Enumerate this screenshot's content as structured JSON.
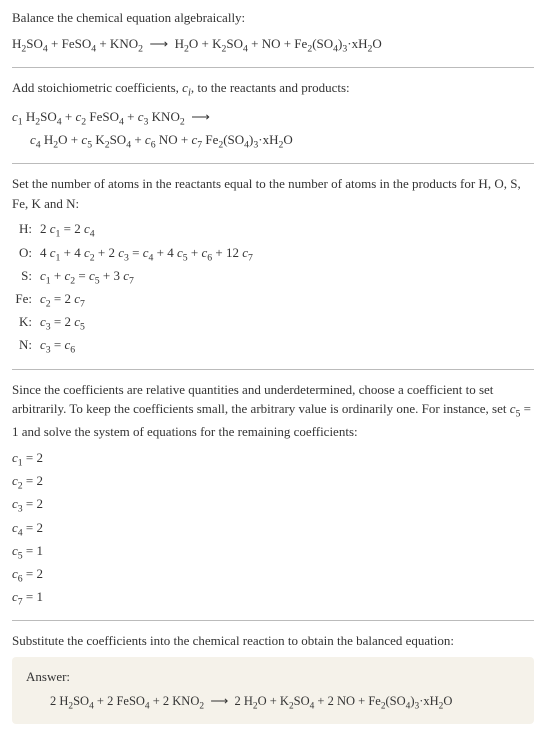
{
  "intro_text": "Balance the chemical equation algebraically:",
  "unbalanced_equation": "H₂SO₄ + FeSO₄ + KNO₂ ⟶ H₂O + K₂SO₄ + NO + Fe₂(SO₄)₃·xH₂O",
  "stoich_text_part1": "Add stoichiometric coefficients, ",
  "stoich_text_ci": "cᵢ",
  "stoich_text_part2": ", to the reactants and products:",
  "stoich_equation_line1": "c₁ H₂SO₄ + c₂ FeSO₄ + c₃ KNO₂ ⟶",
  "stoich_equation_line2": "c₄ H₂O + c₅ K₂SO₄ + c₆ NO + c₇ Fe₂(SO₄)₃·xH₂O",
  "atoms_text": "Set the number of atoms in the reactants equal to the number of atoms in the products for H, O, S, Fe, K and N:",
  "balance_rows": [
    {
      "label": "H:",
      "eq": "2 c₁ = 2 c₄"
    },
    {
      "label": "O:",
      "eq": "4 c₁ + 4 c₂ + 2 c₃ = c₄ + 4 c₅ + c₆ + 12 c₇"
    },
    {
      "label": "S:",
      "eq": "c₁ + c₂ = c₅ + 3 c₇"
    },
    {
      "label": "Fe:",
      "eq": "c₂ = 2 c₇"
    },
    {
      "label": "K:",
      "eq": "c₃ = 2 c₅"
    },
    {
      "label": "N:",
      "eq": "c₃ = c₆"
    }
  ],
  "undetermined_text": "Since the coefficients are relative quantities and underdetermined, choose a coefficient to set arbitrarily. To keep the coefficients small, the arbitrary value is ordinarily one. For instance, set c₅ = 1 and solve the system of equations for the remaining coefficients:",
  "coefficients": [
    "c₁ = 2",
    "c₂ = 2",
    "c₃ = 2",
    "c₄ = 2",
    "c₅ = 1",
    "c₆ = 2",
    "c₇ = 1"
  ],
  "substitute_text": "Substitute the coefficients into the chemical reaction to obtain the balanced equation:",
  "answer_label": "Answer:",
  "answer_equation": "2 H₂SO₄ + 2 FeSO₄ + 2 KNO₂ ⟶ 2 H₂O + K₂SO₄ + 2 NO + Fe₂(SO₄)₃·xH₂O"
}
